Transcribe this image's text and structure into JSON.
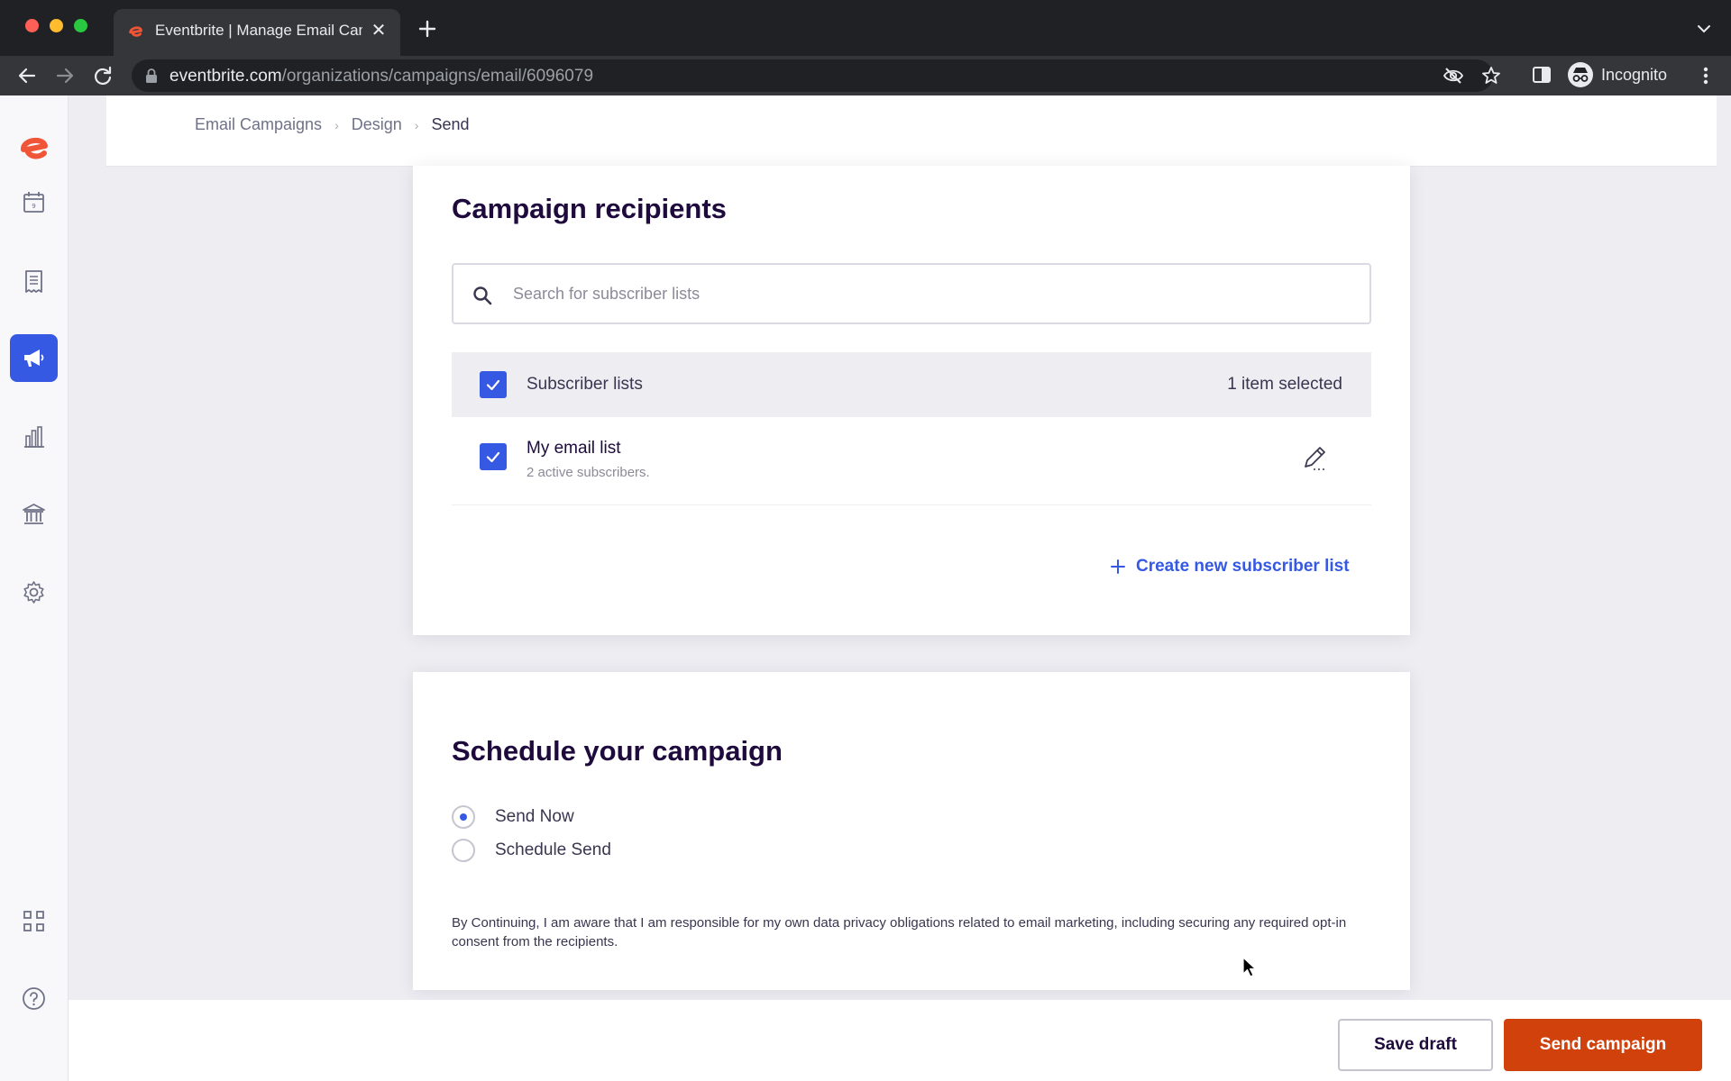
{
  "browser": {
    "tab_title": "Eventbrite | Manage Email Cam",
    "url_host": "eventbrite.com",
    "url_path": "/organizations/campaigns/email/6096079",
    "profile_label": "Incognito"
  },
  "breadcrumb": {
    "items": [
      "Email Campaigns",
      "Design",
      "Send"
    ]
  },
  "recipients": {
    "heading": "Campaign recipients",
    "search_placeholder": "Search for subscriber lists",
    "header_label": "Subscriber lists",
    "selected_count": "1 item selected",
    "lists": [
      {
        "name": "My email list",
        "subtitle": "2 active subscribers.",
        "checked": true
      }
    ],
    "create_link": "Create new subscriber list"
  },
  "schedule": {
    "heading": "Schedule your campaign",
    "options": [
      {
        "label": "Send Now",
        "selected": true
      },
      {
        "label": "Schedule Send",
        "selected": false
      }
    ],
    "disclaimer": "By Continuing, I am aware that I am responsible for my own data privacy obligations related to email marketing, including securing any required opt-in consent from the recipients."
  },
  "footer": {
    "save_label": "Save draft",
    "send_label": "Send campaign"
  },
  "colors": {
    "brand": "#d1410c",
    "accent": "#3659e3",
    "heading": "#1e0a3c"
  },
  "icons": {
    "sidenav": [
      "eventbrite-logo",
      "calendar-icon",
      "orders-icon",
      "megaphone-icon",
      "bar-chart-icon",
      "bank-icon",
      "gear-icon",
      "apps-grid-icon",
      "help-icon"
    ]
  }
}
